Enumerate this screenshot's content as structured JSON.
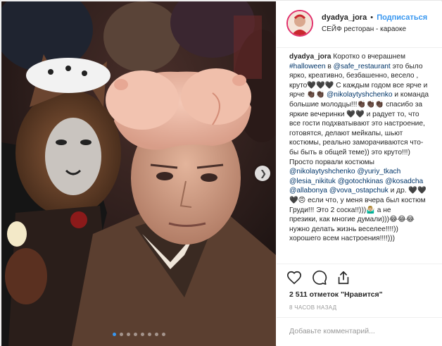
{
  "post": {
    "username": "dyadya_jora",
    "separator": "•",
    "follow_label": "Подписаться",
    "location": "СЕЙФ ресторан - караоке",
    "photo_description_icon": "photo-carousel",
    "carousel_dots": 8,
    "carousel_active": 0
  },
  "caption": {
    "lines": [
      [
        {
          "t": "dyadya_jora",
          "c": "uname"
        },
        {
          "t": " Коротко о вчерашнем"
        }
      ],
      [
        {
          "t": "#halloween",
          "c": "tag"
        },
        {
          "t": " в "
        },
        {
          "t": "@safe_restaurant",
          "c": "tag"
        },
        {
          "t": " это было"
        }
      ],
      [
        {
          "t": "ярко, креативно, безбашенно, весело ,"
        }
      ],
      [
        {
          "t": "круто🖤🖤🖤 С каждым годом все ярче и"
        }
      ],
      [
        {
          "t": "ярче 👏🏿👏🏿 "
        },
        {
          "t": "@nikolaytyshchenko",
          "c": "tag"
        },
        {
          "t": " и команда"
        }
      ],
      [
        {
          "t": "большие молодцы!!!👏🏿👏🏿👏🏿 спасибо за"
        }
      ],
      [
        {
          "t": "яркие вечеринки 🖤🖤 и радует то, что"
        }
      ],
      [
        {
          "t": "все гости подхватывают это настроение,"
        }
      ],
      [
        {
          "t": "готовятся, делают мейкапы, шьют"
        }
      ],
      [
        {
          "t": "костюмы, реально заморачиваются что-"
        }
      ],
      [
        {
          "t": "бы быть в общей теме)) это круто!!!)"
        }
      ],
      [
        {
          "t": "Просто порвали костюмы"
        }
      ],
      [
        {
          "t": "@nikolaytyshchenko",
          "c": "tag"
        },
        {
          "t": " "
        },
        {
          "t": "@yuriy_tkach",
          "c": "tag"
        }
      ],
      [
        {
          "t": "@lesia_nikituk",
          "c": "tag"
        },
        {
          "t": " "
        },
        {
          "t": "@gotochkinas",
          "c": "tag"
        },
        {
          "t": " "
        },
        {
          "t": "@kosadcha",
          "c": "tag"
        }
      ],
      [
        {
          "t": "@allabonya",
          "c": "tag"
        },
        {
          "t": " "
        },
        {
          "t": "@vova_ostapchuk",
          "c": "tag"
        },
        {
          "t": " и др. 🖤🖤"
        }
      ],
      [
        {
          "t": "🖤😠 если что, у меня вчера был костюм"
        }
      ],
      [
        {
          "t": "Груди!!! Это 2 соска!!)))🤷🏼‍♂️ а не"
        }
      ],
      [
        {
          "t": "презики, как многие думали)))😂😂😂"
        }
      ],
      [
        {
          "t": "нужно делать жизнь веселее!!!!))"
        }
      ],
      [
        {
          "t": "хорошего всем настроения!!!!)))"
        }
      ]
    ]
  },
  "actions": {
    "like_icon": "heart-icon",
    "comment_icon": "comment-icon",
    "share_icon": "share-icon"
  },
  "likes_text": "2 511 отметок \"Нравится\"",
  "time_ago": "8 ЧАСОВ НАЗАД",
  "comment": {
    "placeholder": "Добавьте комментарий..."
  },
  "colors": {
    "link": "#3897f0",
    "tag": "#003569",
    "muted": "#999999",
    "ring": "#e1306c"
  }
}
